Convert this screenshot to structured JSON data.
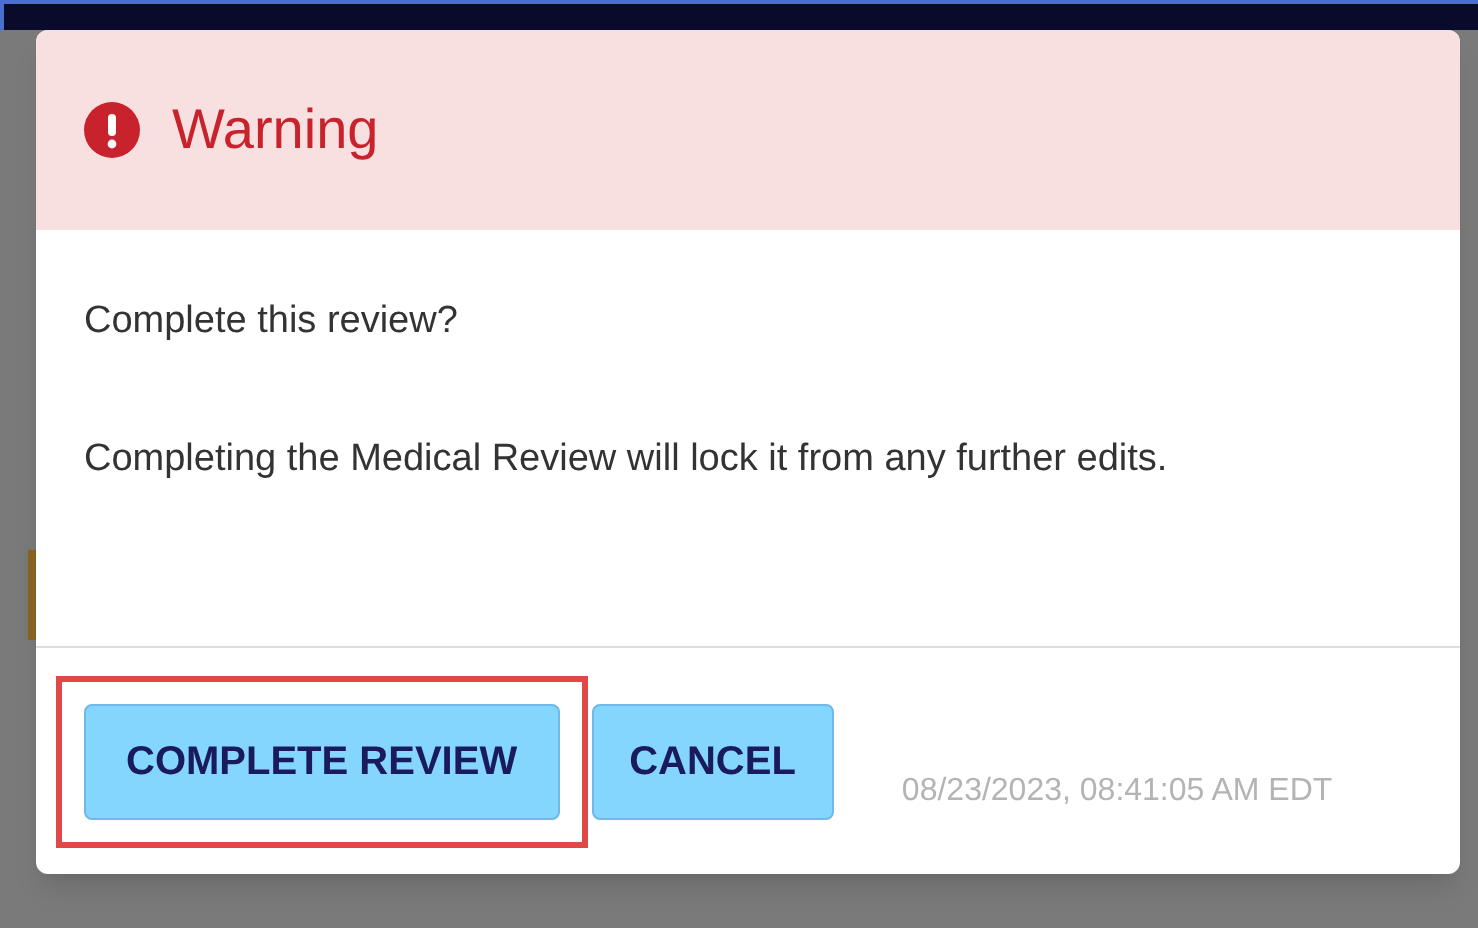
{
  "dialog": {
    "title": "Warning",
    "message": [
      "Complete this review?",
      "Completing the Medical Review will lock it from any further edits."
    ],
    "buttons": [
      {
        "label": "COMPLETE REVIEW",
        "highlighted": true
      },
      {
        "label": "CANCEL",
        "highlighted": false
      }
    ],
    "timestamp": "08/23/2023, 08:41:05 AM EDT"
  }
}
